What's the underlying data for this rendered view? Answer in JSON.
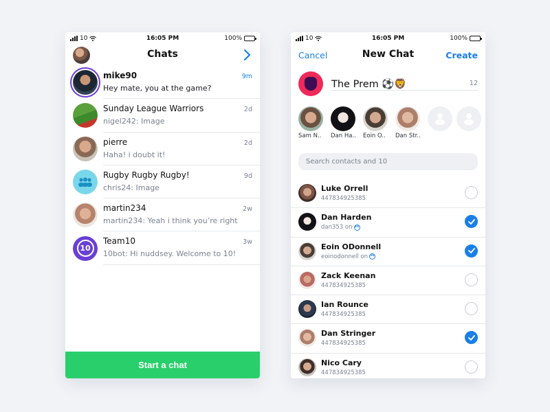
{
  "status_bar": {
    "carrier": "10",
    "time": "16:05 PM",
    "battery": "100%"
  },
  "chats_screen": {
    "title": "Chats",
    "chats": [
      {
        "name": "mike90",
        "message": "Hey mate, you at the game?",
        "time": "9m",
        "unread": true
      },
      {
        "name": "Sunday League Warriors",
        "message": "nigel242: Image",
        "time": "2d",
        "unread": false
      },
      {
        "name": "pierre",
        "message": "Haha! i doubt it!",
        "time": "2d",
        "unread": false
      },
      {
        "name": "Rugby Rugby Rugby!",
        "message": "chris24: Image",
        "time": "9d",
        "unread": false
      },
      {
        "name": "martin234",
        "message": "martin234: Yeah i think you’re right",
        "time": "2w",
        "unread": false
      },
      {
        "name": "Team10",
        "message": "10bot: Hi nuddsey. Welcome to 10!",
        "time": "3w",
        "unread": false
      }
    ],
    "team10_logo_text": "10",
    "start_chat_label": "Start a chat"
  },
  "new_chat_screen": {
    "title": "New Chat",
    "cancel_label": "Cancel",
    "create_label": "Create",
    "group_name": "The Prem ⚽🦁",
    "group_name_count": "12",
    "selected": [
      {
        "label": "Sam N.."
      },
      {
        "label": "Dan Ha.."
      },
      {
        "label": "Eoin O.."
      },
      {
        "label": "Dan Str.."
      }
    ],
    "search_placeholder": "Search contacts and 10",
    "contacts": [
      {
        "name": "Luke Orrell",
        "detail": "447834925385",
        "on_app": false,
        "checked": false
      },
      {
        "name": "Dan Harden",
        "detail": "dan353 on",
        "on_app": true,
        "checked": true
      },
      {
        "name": "Eoin ODonnell",
        "detail": "eoinodonnell on",
        "on_app": true,
        "checked": true
      },
      {
        "name": "Zack Keenan",
        "detail": "447834925385",
        "on_app": false,
        "checked": false
      },
      {
        "name": "Ian Rounce",
        "detail": "447834925385",
        "on_app": false,
        "checked": false
      },
      {
        "name": "Dan Stringer",
        "detail": "447834925385",
        "on_app": false,
        "checked": true
      },
      {
        "name": "Nico Cary",
        "detail": "447834925385",
        "on_app": false,
        "checked": false
      }
    ],
    "app_badge_text": "10"
  },
  "colors": {
    "accent": "#1a7ee8",
    "start_button": "#29cf6a",
    "team10_purple": "#6a3fd4",
    "prem_pink": "#ee2a5b",
    "background": "#f1f3f7"
  },
  "icons": [
    "wifi-icon",
    "signal-icon",
    "battery-icon",
    "chevron-right-icon",
    "checkmark-icon",
    "user-placeholder-icon",
    "group-icon",
    "premier-league-lion-icon"
  ]
}
